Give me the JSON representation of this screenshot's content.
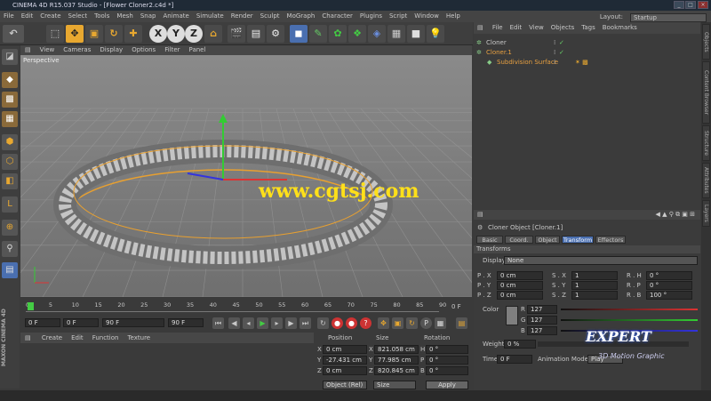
{
  "app": {
    "title": "CINEMA 4D R15.037 Studio - [Flower Cloner2.c4d *]"
  },
  "menu": [
    "File",
    "Edit",
    "Create",
    "Select",
    "Tools",
    "Mesh",
    "Snap",
    "Animate",
    "Simulate",
    "Render",
    "Sculpt",
    "MoGraph",
    "Character",
    "Plugins",
    "Script",
    "Window",
    "Help"
  ],
  "layout": {
    "label": "Layout:",
    "value": "Startup"
  },
  "toolbar": {
    "x": "X",
    "y": "Y",
    "z": "Z"
  },
  "viewport": {
    "menu": [
      "View",
      "Cameras",
      "Display",
      "Options",
      "Filter",
      "Panel"
    ],
    "label": "Perspective",
    "watermark": "www.cgtsj.com"
  },
  "timeline": {
    "ticks": [
      "0",
      "5",
      "10",
      "15",
      "20",
      "25",
      "30",
      "35",
      "40",
      "45",
      "50",
      "55",
      "60",
      "65",
      "70",
      "75",
      "80",
      "85",
      "90"
    ],
    "end": "0 F"
  },
  "transport": {
    "current": "0 F",
    "start": "0 F",
    "end_field": "90 F",
    "max": "90 F"
  },
  "material": {
    "menu": [
      "Create",
      "Edit",
      "Function",
      "Texture"
    ]
  },
  "coordinates": {
    "headers": [
      "Position",
      "Size",
      "Rotation"
    ],
    "rows": [
      {
        "axis": "X",
        "pos": "0 cm",
        "size_axis": "X",
        "size": "821.058 cm",
        "rot_axis": "H",
        "rot": "0 °"
      },
      {
        "axis": "Y",
        "pos": "-27.431 cm",
        "size_axis": "Y",
        "size": "77.985 cm",
        "rot_axis": "P",
        "rot": "0 °"
      },
      {
        "axis": "Z",
        "pos": "0 cm",
        "size_axis": "Z",
        "size": "820.845 cm",
        "rot_axis": "B",
        "rot": "0 °"
      }
    ],
    "mode": "Object (Rel)",
    "size_mode": "Size",
    "apply": "Apply"
  },
  "objects": {
    "menu": [
      "File",
      "Edit",
      "View",
      "Objects",
      "Tags",
      "Bookmarks"
    ],
    "items": [
      {
        "name": "Cloner",
        "color": "#c8c8c8"
      },
      {
        "name": "Cloner.1",
        "color": "#e8a040"
      },
      {
        "name": "Subdivision Surface",
        "color": "#e8a040"
      }
    ]
  },
  "attributes": {
    "menu": [
      "Mode",
      "Edit",
      "User Data"
    ],
    "title": "Cloner Object [Cloner.1]",
    "tabs": [
      "Basic",
      "Coord.",
      "Object",
      "Transform",
      "Effectors"
    ],
    "section": "Transforms",
    "display_label": "Display",
    "display_value": "None",
    "pos": [
      {
        "l": "P . X",
        "v": "0 cm"
      },
      {
        "l": "P . Y",
        "v": "0 cm"
      },
      {
        "l": "P . Z",
        "v": "0 cm"
      }
    ],
    "scale": [
      {
        "l": "S . X",
        "v": "1"
      },
      {
        "l": "S . Y",
        "v": "1"
      },
      {
        "l": "S . Z",
        "v": "1"
      }
    ],
    "rot": [
      {
        "l": "R . H",
        "v": "0 °"
      },
      {
        "l": "R . P",
        "v": "0 °"
      },
      {
        "l": "R . B",
        "v": "100 °"
      }
    ],
    "color_label": "Color",
    "rgb": [
      {
        "l": "R",
        "v": "127"
      },
      {
        "l": "G",
        "v": "127"
      },
      {
        "l": "B",
        "v": "127"
      }
    ],
    "weight_label": "Weight",
    "weight_value": "0 %",
    "time_label": "Time",
    "time_value": "0 F",
    "anim_label": "Animation Mode",
    "anim_value": "Play"
  },
  "sidetabs": [
    "Objects",
    "Content Browser",
    "Structure",
    "Attributes",
    "Layers"
  ],
  "branding": {
    "maxon": "MAXON",
    "c4d": "CINEMA 4D",
    "logo": "EXPERT",
    "motion": "3D Motion Graphic"
  }
}
